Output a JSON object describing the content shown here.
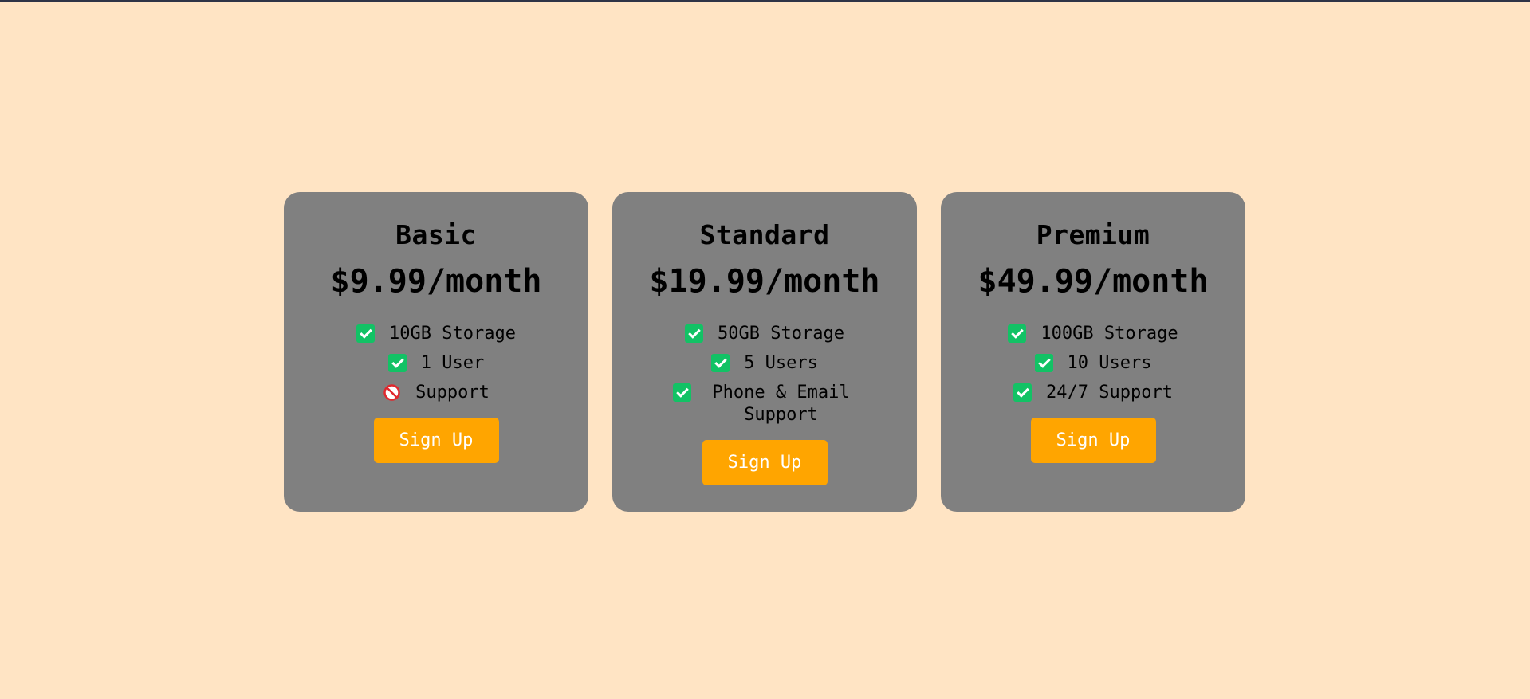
{
  "plans": [
    {
      "name": "Basic",
      "price": "$9.99/month",
      "features": [
        {
          "text": "10GB Storage",
          "included": true
        },
        {
          "text": "1 User",
          "included": true
        },
        {
          "text": "Support",
          "included": false
        }
      ],
      "button_label": "Sign Up"
    },
    {
      "name": "Standard",
      "price": "$19.99/month",
      "features": [
        {
          "text": "50GB Storage",
          "included": true
        },
        {
          "text": "5 Users",
          "included": true
        },
        {
          "text": "Phone & Email Support",
          "included": true
        }
      ],
      "button_label": "Sign Up"
    },
    {
      "name": "Premium",
      "price": "$49.99/month",
      "features": [
        {
          "text": "100GB Storage",
          "included": true
        },
        {
          "text": "10 Users",
          "included": true
        },
        {
          "text": "24/7 Support",
          "included": true
        }
      ],
      "button_label": "Sign Up"
    }
  ],
  "icons": {
    "included": "check-box-icon",
    "excluded": "prohibited-icon"
  },
  "colors": {
    "page_background": "#ffe4c4",
    "card_background": "#808080",
    "button_background": "#ffa500",
    "check_green": "#12c265",
    "prohibited_red": "#e0282e"
  }
}
